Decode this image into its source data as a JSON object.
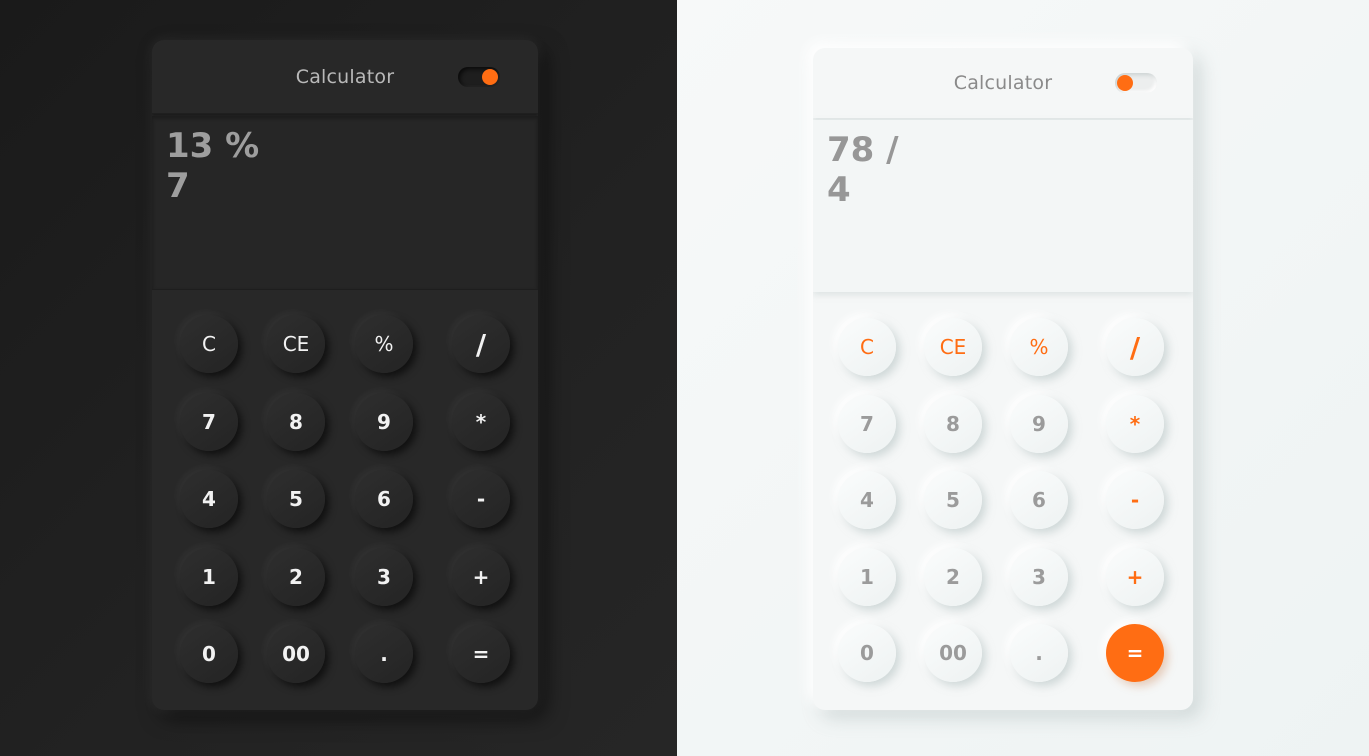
{
  "dark": {
    "title": "Calculator",
    "display": {
      "expression": "13 %",
      "value": "7"
    },
    "keys": [
      [
        "C",
        "CE",
        "%",
        "/"
      ],
      [
        "7",
        "8",
        "9",
        "*"
      ],
      [
        "4",
        "5",
        "6",
        "-"
      ],
      [
        "1",
        "2",
        "3",
        "+"
      ],
      [
        "0",
        "00",
        ".",
        "="
      ]
    ]
  },
  "light": {
    "title": "Calculator",
    "display": {
      "expression": "78 /",
      "value": "4"
    },
    "keys": [
      [
        "C",
        "CE",
        "%",
        "/"
      ],
      [
        "7",
        "8",
        "9",
        "*"
      ],
      [
        "4",
        "5",
        "6",
        "-"
      ],
      [
        "1",
        "2",
        "3",
        "+"
      ],
      [
        "0",
        "00",
        ".",
        "="
      ]
    ]
  },
  "colors": {
    "accent": "#ff6d13",
    "dark_bg": "#1f1f1f",
    "dark_panel": "#282828",
    "light_bg": "#f2f6f6",
    "light_panel": "#f5f7f7"
  }
}
